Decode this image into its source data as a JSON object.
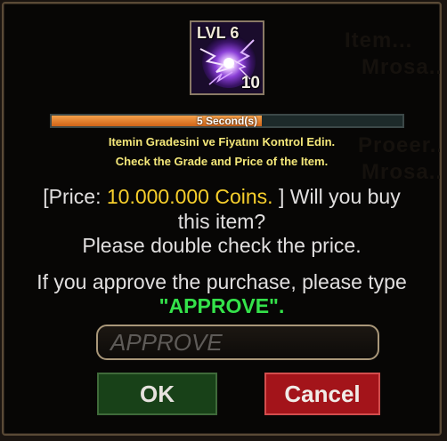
{
  "background_text": [
    "Item...",
    "Mrosa...",
    "Proeer...",
    "Mrosa..."
  ],
  "item": {
    "level_label": "LVL 6",
    "count": "10",
    "icon": "purple-lightning-orb-icon"
  },
  "timer": {
    "label": "5 Second(s)",
    "progress": 0.6,
    "fill_color": "#e07a2a"
  },
  "notice": {
    "line_tr": "Itemin Gradesini ve Fiyatını Kontrol Edin.",
    "line_en": "Check the Grade and Price of the Item."
  },
  "message": {
    "price_prefix": "[Price: ",
    "price_value": "10.000.000 Coins.",
    "price_suffix": " ] Will you buy",
    "line2": "this item?",
    "line3": "Please double check the price.",
    "approve_prefix": "If you approve the purchase, please type",
    "approve_word": "\"APPROVE\"."
  },
  "input": {
    "placeholder": "APPROVE",
    "value": ""
  },
  "buttons": {
    "ok_label": "OK",
    "cancel_label": "Cancel"
  },
  "colors": {
    "price": "#f7cf2c",
    "approve_word": "#34e24a",
    "notice": "#f5e87a",
    "ok_bg": "#184118",
    "cancel_bg": "#a3141a"
  }
}
